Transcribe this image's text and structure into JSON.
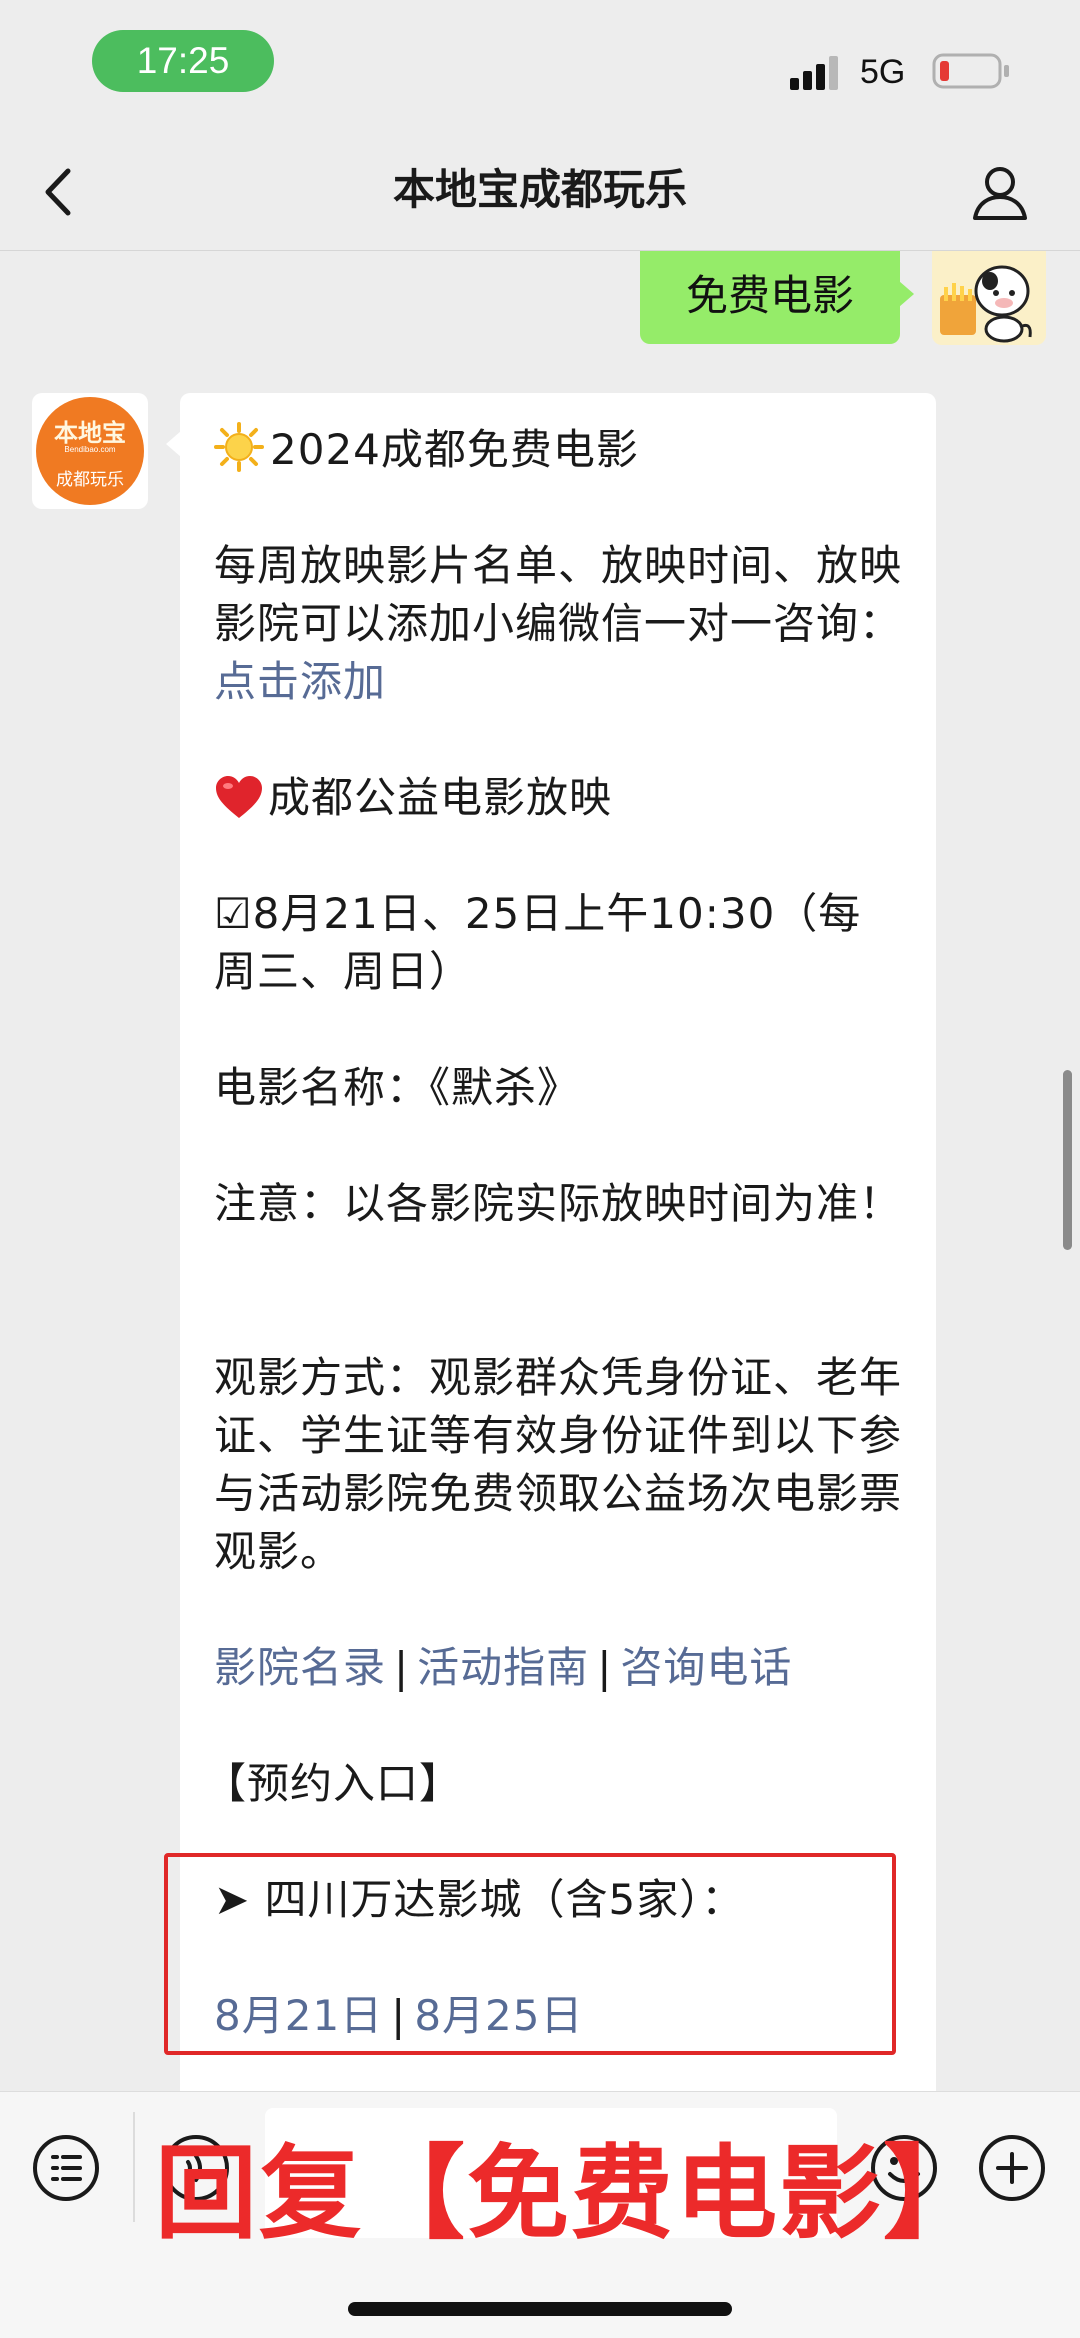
{
  "status_bar": {
    "time": "17:25",
    "network": "5G",
    "signal_icon": "signal-bars-icon",
    "battery_icon": "battery-low-icon",
    "battery_color": "#e53935"
  },
  "nav": {
    "title": "本地宝成都玩乐",
    "back_icon": "chevron-left-icon",
    "profile_icon": "user-icon"
  },
  "chat": {
    "outgoing_message": "免费电影",
    "bot_avatar": {
      "top_text": "本地宝",
      "url_text": "Bendibao.com",
      "bottom_text": "成都玩乐",
      "color": "#f07a22"
    },
    "incoming": {
      "heading_1": "2024成都免费电影",
      "intro_text": "每周放映影片名单、放映时间、放映影院可以添加小编微信一对一咨询：",
      "intro_link": "点击添加",
      "heading_2": "成都公益电影放映",
      "schedule": "☑8月21日、25日上午10:30（每周三、周日）",
      "movie_name": "电影名称：《默杀》",
      "notice": "注意：以各影院实际放映时间为准！",
      "method": "观影方式：观影群众凭身份证、老年证、学生证等有效身份证件到以下参与活动影院免费领取公益场次电影票观影。",
      "links": [
        "影院名录",
        "活动指南",
        "咨询电话"
      ],
      "separator": "|",
      "booking_label": "【预约入口】",
      "cinema": "➤ 四川万达影城（含5家）：",
      "dates": [
        "8月21日",
        "8月25日"
      ]
    }
  },
  "input_bar": {
    "menu_icon": "list-menu-icon",
    "voice_icon": "voice-icon",
    "emoji_icon": "smiley-icon",
    "plus_icon": "plus-circle-icon"
  },
  "overlay": {
    "reply_banner": "回复【免费电影】",
    "highlight_color": "#e02828",
    "banner_color": "#ec2a2a"
  },
  "colors": {
    "link": "#576b95",
    "outgoing_bubble": "#95ec69",
    "time_pill": "#4cbd5e",
    "background": "#ededed"
  }
}
